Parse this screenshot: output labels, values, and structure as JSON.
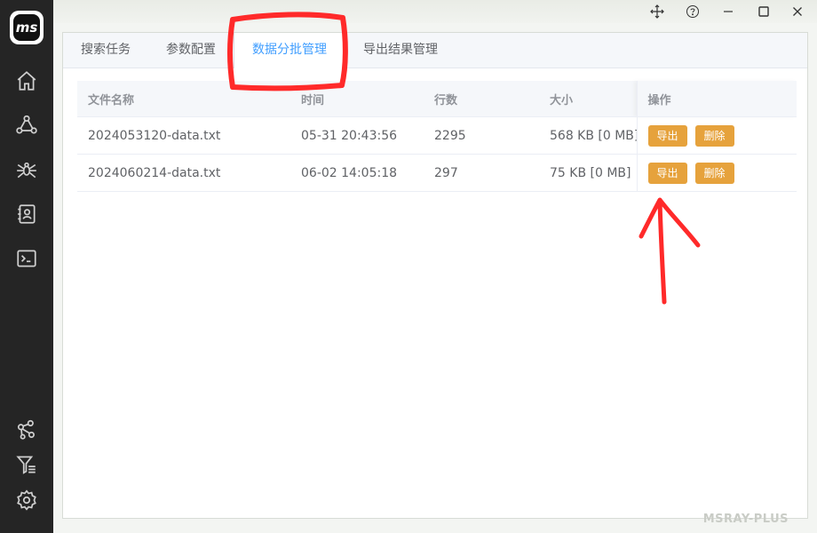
{
  "sidebar": {
    "logo_text": "ms",
    "icons": [
      "home-icon",
      "nodes-icon",
      "spider-icon",
      "contacts-icon",
      "terminal-icon",
      "share-icon",
      "filter-list-icon",
      "gear-icon"
    ]
  },
  "titlebar": {
    "controls": [
      "move-icon",
      "help-icon",
      "minimize-icon",
      "maximize-icon",
      "close-icon"
    ]
  },
  "tabs": [
    {
      "label": "搜索任务"
    },
    {
      "label": "参数配置"
    },
    {
      "label": "数据分批管理"
    },
    {
      "label": "导出结果管理"
    }
  ],
  "active_tab": "数据分批管理",
  "table": {
    "headers": [
      "文件名称",
      "时间",
      "行数",
      "大小",
      "操作"
    ],
    "rows": [
      {
        "name": "2024053120-data.txt",
        "time": "05-31 20:43:56",
        "lines": "2295",
        "size": "568 KB [0 MB]",
        "export": "导出",
        "delete": "删除"
      },
      {
        "name": "2024060214-data.txt",
        "time": "06-02 14:05:18",
        "lines": "297",
        "size": "75 KB [0 MB]",
        "export": "导出",
        "delete": "删除"
      }
    ]
  },
  "watermark": "MSRAY-PLUS",
  "colors": {
    "sidebar_bg": "#252525",
    "active_tab": "#409eff",
    "button_warning": "#e6a23c",
    "annotation": "#ff2a2a"
  }
}
